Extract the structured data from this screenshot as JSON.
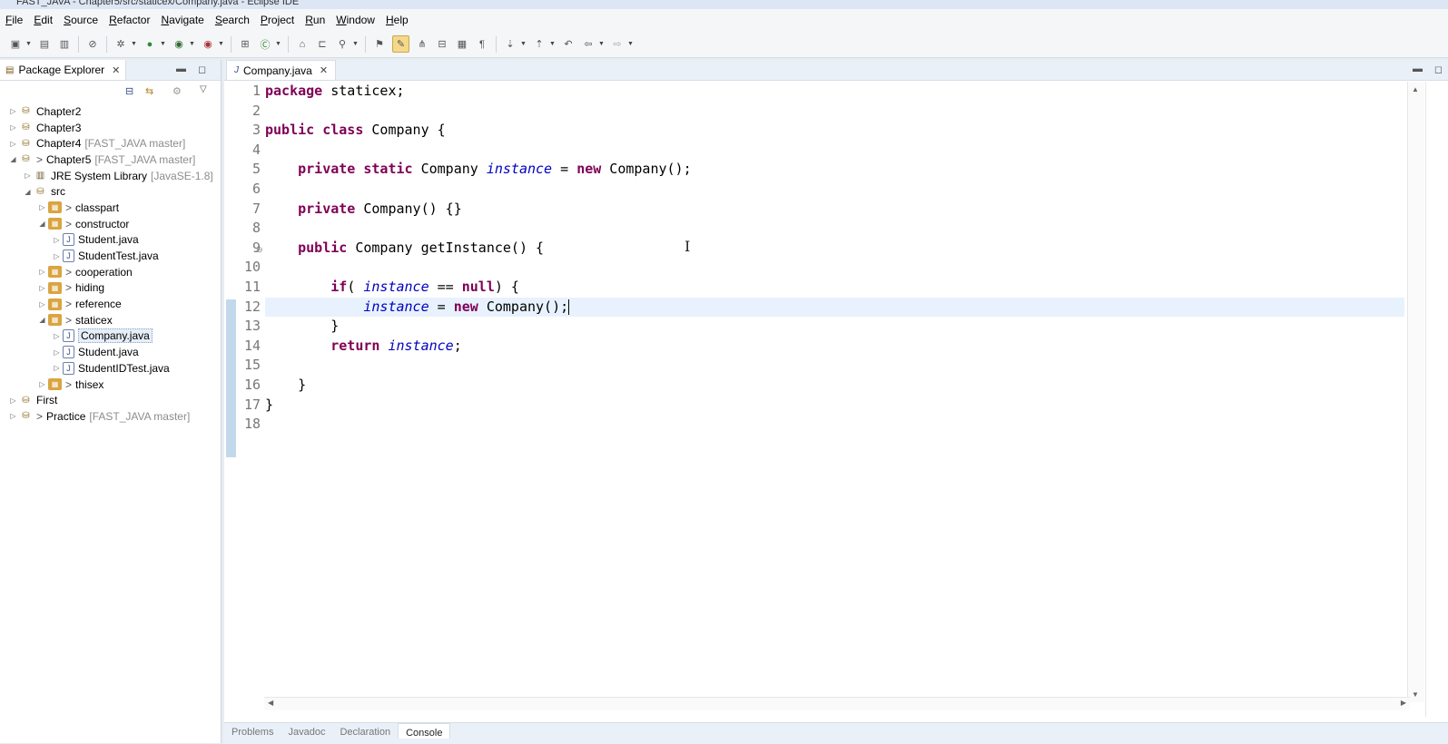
{
  "window": {
    "title": "FAST_JAVA - Chapter5/src/staticex/Company.java - Eclipse IDE"
  },
  "menu": [
    "File",
    "Edit",
    "Source",
    "Refactor",
    "Navigate",
    "Search",
    "Project",
    "Run",
    "Window",
    "Help"
  ],
  "explorer": {
    "title": "Package Explorer",
    "tree": [
      {
        "label": "Chapter2",
        "git": "",
        "icon": "project-icon",
        "depth": 0,
        "arrow": "▷",
        "gt": ""
      },
      {
        "label": "Chapter3",
        "git": "",
        "icon": "project-icon",
        "depth": 0,
        "arrow": "▷",
        "gt": ""
      },
      {
        "label": "Chapter4",
        "git": "[FAST_JAVA master]",
        "icon": "project-icon",
        "depth": 0,
        "arrow": "▷",
        "gt": ""
      },
      {
        "label": "Chapter5",
        "git": "[FAST_JAVA master]",
        "icon": "project-icon",
        "depth": 0,
        "arrow": "◢",
        "gt": ">"
      },
      {
        "label": "JRE System Library",
        "git": "[JavaSE-1.8]",
        "icon": "library-icon",
        "depth": 1,
        "arrow": "▷",
        "gt": ""
      },
      {
        "label": "src",
        "git": "",
        "icon": "source-folder-icon",
        "depth": 1,
        "arrow": "◢",
        "gt": ""
      },
      {
        "label": "classpart",
        "git": "",
        "icon": "package-icon",
        "depth": 2,
        "arrow": "▷",
        "gt": ">"
      },
      {
        "label": "constructor",
        "git": "",
        "icon": "package-icon",
        "depth": 2,
        "arrow": "◢",
        "gt": ">"
      },
      {
        "label": "Student.java",
        "git": "",
        "icon": "java-file-icon",
        "depth": 3,
        "arrow": "▷",
        "gt": ""
      },
      {
        "label": "StudentTest.java",
        "git": "",
        "icon": "java-file-icon",
        "depth": 3,
        "arrow": "▷",
        "gt": ""
      },
      {
        "label": "cooperation",
        "git": "",
        "icon": "package-icon",
        "depth": 2,
        "arrow": "▷",
        "gt": ">"
      },
      {
        "label": "hiding",
        "git": "",
        "icon": "package-icon",
        "depth": 2,
        "arrow": "▷",
        "gt": ">"
      },
      {
        "label": "reference",
        "git": "",
        "icon": "package-icon",
        "depth": 2,
        "arrow": "▷",
        "gt": ">"
      },
      {
        "label": "staticex",
        "git": "",
        "icon": "package-icon",
        "depth": 2,
        "arrow": "◢",
        "gt": ">"
      },
      {
        "label": "Company.java",
        "git": "",
        "icon": "java-file-icon",
        "depth": 3,
        "arrow": "▷",
        "gt": "",
        "selected": true
      },
      {
        "label": "Student.java",
        "git": "",
        "icon": "java-file-icon",
        "depth": 3,
        "arrow": "▷",
        "gt": ""
      },
      {
        "label": "StudentIDTest.java",
        "git": "",
        "icon": "java-file-icon",
        "depth": 3,
        "arrow": "▷",
        "gt": ""
      },
      {
        "label": "thisex",
        "git": "",
        "icon": "package-icon",
        "depth": 2,
        "arrow": "▷",
        "gt": ">"
      },
      {
        "label": "First",
        "git": "",
        "icon": "project-icon",
        "depth": 0,
        "arrow": "▷",
        "gt": ""
      },
      {
        "label": "Practice",
        "git": "[FAST_JAVA master]",
        "icon": "project-icon",
        "depth": 0,
        "arrow": "▷",
        "gt": ">"
      }
    ]
  },
  "editor": {
    "tab": "Company.java",
    "current_line": 12,
    "lines": [
      [
        [
          "kw",
          "package"
        ],
        [
          "t",
          " staticex;"
        ]
      ],
      [],
      [
        [
          "kw",
          "public"
        ],
        [
          "t",
          " "
        ],
        [
          "kw",
          "class"
        ],
        [
          "t",
          " Company {"
        ]
      ],
      [],
      [
        [
          "t",
          "    "
        ],
        [
          "kw",
          "private"
        ],
        [
          "t",
          " "
        ],
        [
          "kw",
          "static"
        ],
        [
          "t",
          " Company "
        ],
        [
          "fld",
          "instance"
        ],
        [
          "t",
          " = "
        ],
        [
          "kw",
          "new"
        ],
        [
          "t",
          " Company();"
        ]
      ],
      [],
      [
        [
          "t",
          "    "
        ],
        [
          "kw",
          "private"
        ],
        [
          "t",
          " Company() {}"
        ]
      ],
      [],
      [
        [
          "t",
          "    "
        ],
        [
          "kw",
          "public"
        ],
        [
          "t",
          " Company getInstance() {"
        ]
      ],
      [],
      [
        [
          "t",
          "        "
        ],
        [
          "kw",
          "if"
        ],
        [
          "t",
          "( "
        ],
        [
          "fld",
          "instance"
        ],
        [
          "t",
          " == "
        ],
        [
          "kw",
          "null"
        ],
        [
          "t",
          ") {"
        ]
      ],
      [
        [
          "t",
          "            "
        ],
        [
          "fld",
          "instance"
        ],
        [
          "t",
          " = "
        ],
        [
          "kw",
          "new"
        ],
        [
          "t",
          " Company();"
        ],
        [
          "caret",
          ""
        ]
      ],
      [
        [
          "t",
          "        }"
        ]
      ],
      [
        [
          "t",
          "        "
        ],
        [
          "kw",
          "return"
        ],
        [
          "t",
          " "
        ],
        [
          "fld",
          "instance"
        ],
        [
          "t",
          ";"
        ]
      ],
      [],
      [
        [
          "t",
          "    }"
        ]
      ],
      [
        [
          "t",
          "}"
        ]
      ],
      []
    ]
  },
  "bottom_tabs": [
    "Problems",
    "Javadoc",
    "Declaration",
    "Console"
  ],
  "bottom_active": "Console"
}
